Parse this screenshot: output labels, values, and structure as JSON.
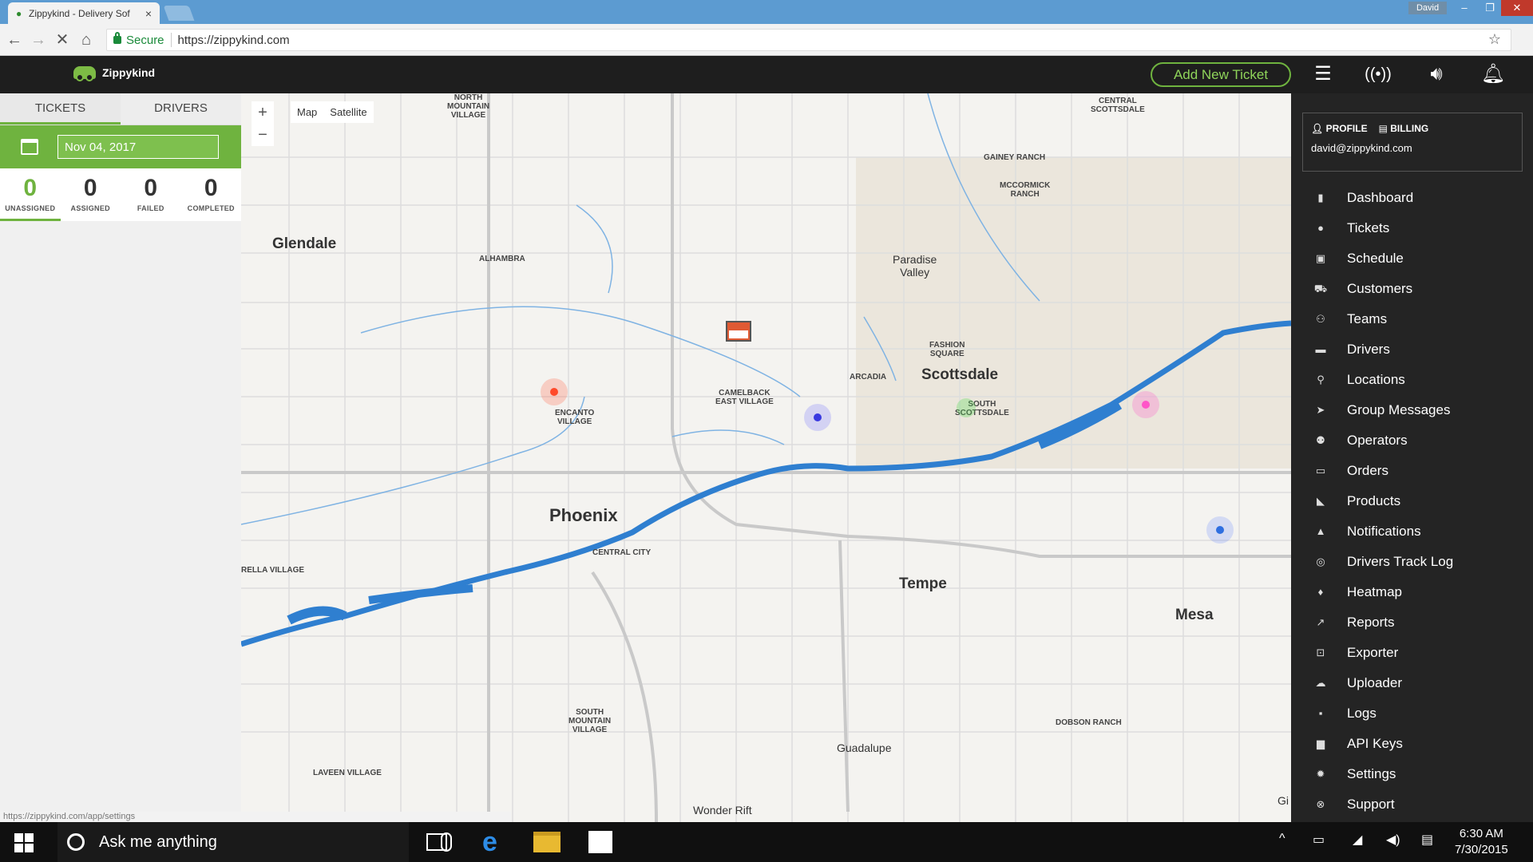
{
  "browser": {
    "tab_title": "Zippykind - Delivery Sof",
    "tab_close": "×",
    "user_chip": "David",
    "secure_label": "Secure",
    "url": "https://zippykind.com",
    "status_url": "https://zippykind.com/app/settings"
  },
  "header": {
    "logo_text": "Zippykind",
    "add_ticket_label": "Add New Ticket"
  },
  "left": {
    "tabs": [
      "TICKETS",
      "DRIVERS"
    ],
    "date_value": "Nov 04, 2017",
    "stats": [
      {
        "count": "0",
        "label": "UNASSIGNED"
      },
      {
        "count": "0",
        "label": "ASSIGNED"
      },
      {
        "count": "0",
        "label": "FAILED"
      },
      {
        "count": "0",
        "label": "COMPLETED"
      }
    ]
  },
  "map": {
    "zoom_in": "+",
    "zoom_out": "−",
    "type_map": "Map",
    "type_satellite": "Satellite",
    "labels": {
      "north_mountain": "NORTH\nMOUNTAIN\nVILLAGE",
      "glendale": "Glendale",
      "alhambra": "ALHAMBRA",
      "paradise_valley": "Paradise\nValley",
      "gainey_ranch": "GAINEY RANCH",
      "mccormick_ranch": "MCCORMICK\nRANCH",
      "central_scottsdale": "CENTRAL\nSCOTTSDALE",
      "fashion_square": "FASHION\nSQUARE",
      "arcadia": "ARCADIA",
      "scottsdale": "Scottsdale",
      "camelback_east": "CAMELBACK\nEAST VILLAGE",
      "encanto": "ENCANTO\nVILLAGE",
      "south_scottsdale": "SOUTH\nSCOTTSDALE",
      "phoenix": "Phoenix",
      "central_city": "CENTRAL CITY",
      "estrella": "RELLA VILLAGE",
      "tempe": "Tempe",
      "mesa": "Mesa",
      "south_mountain": "SOUTH\nMOUNTAIN\nVILLAGE",
      "guadalupe": "Guadalupe",
      "laveen": "LAVEEN VILLAGE",
      "dobson_ranch": "DOBSON RANCH",
      "wonder_rift": "Wonder Rift",
      "gi": "Gi"
    }
  },
  "profile": {
    "profile_label": "PROFILE",
    "billing_label": "BILLING",
    "email": "david@zippykind.com"
  },
  "nav": [
    {
      "label": "Dashboard",
      "icon": "map-icon"
    },
    {
      "label": "Tickets",
      "icon": "check-circle-icon"
    },
    {
      "label": "Schedule",
      "icon": "calendar-icon"
    },
    {
      "label": "Customers",
      "icon": "cart-icon"
    },
    {
      "label": "Teams",
      "icon": "team-icon"
    },
    {
      "label": "Drivers",
      "icon": "car-icon"
    },
    {
      "label": "Locations",
      "icon": "pin-icon"
    },
    {
      "label": "Group Messages",
      "icon": "send-icon"
    },
    {
      "label": "Operators",
      "icon": "users-icon"
    },
    {
      "label": "Orders",
      "icon": "card-icon"
    },
    {
      "label": "Products",
      "icon": "tag-icon"
    },
    {
      "label": "Notifications",
      "icon": "bell-icon"
    },
    {
      "label": "Drivers Track Log",
      "icon": "target-icon"
    },
    {
      "label": "Heatmap",
      "icon": "flame-icon"
    },
    {
      "label": "Reports",
      "icon": "chart-icon"
    },
    {
      "label": "Exporter",
      "icon": "export-icon"
    },
    {
      "label": "Uploader",
      "icon": "cloud-upload-icon"
    },
    {
      "label": "Logs",
      "icon": "message-icon"
    },
    {
      "label": "API Keys",
      "icon": "lock-icon"
    },
    {
      "label": "Settings",
      "icon": "gear-icon"
    },
    {
      "label": "Support",
      "icon": "lifebuoy-icon"
    }
  ],
  "taskbar": {
    "search_placeholder": "Ask me anything",
    "time": "6:30 AM",
    "date": "7/30/2015"
  },
  "colors": {
    "accent_green": "#6fb33f",
    "water_blue": "#2f7fd0",
    "header_dark": "#1e1e1e"
  }
}
